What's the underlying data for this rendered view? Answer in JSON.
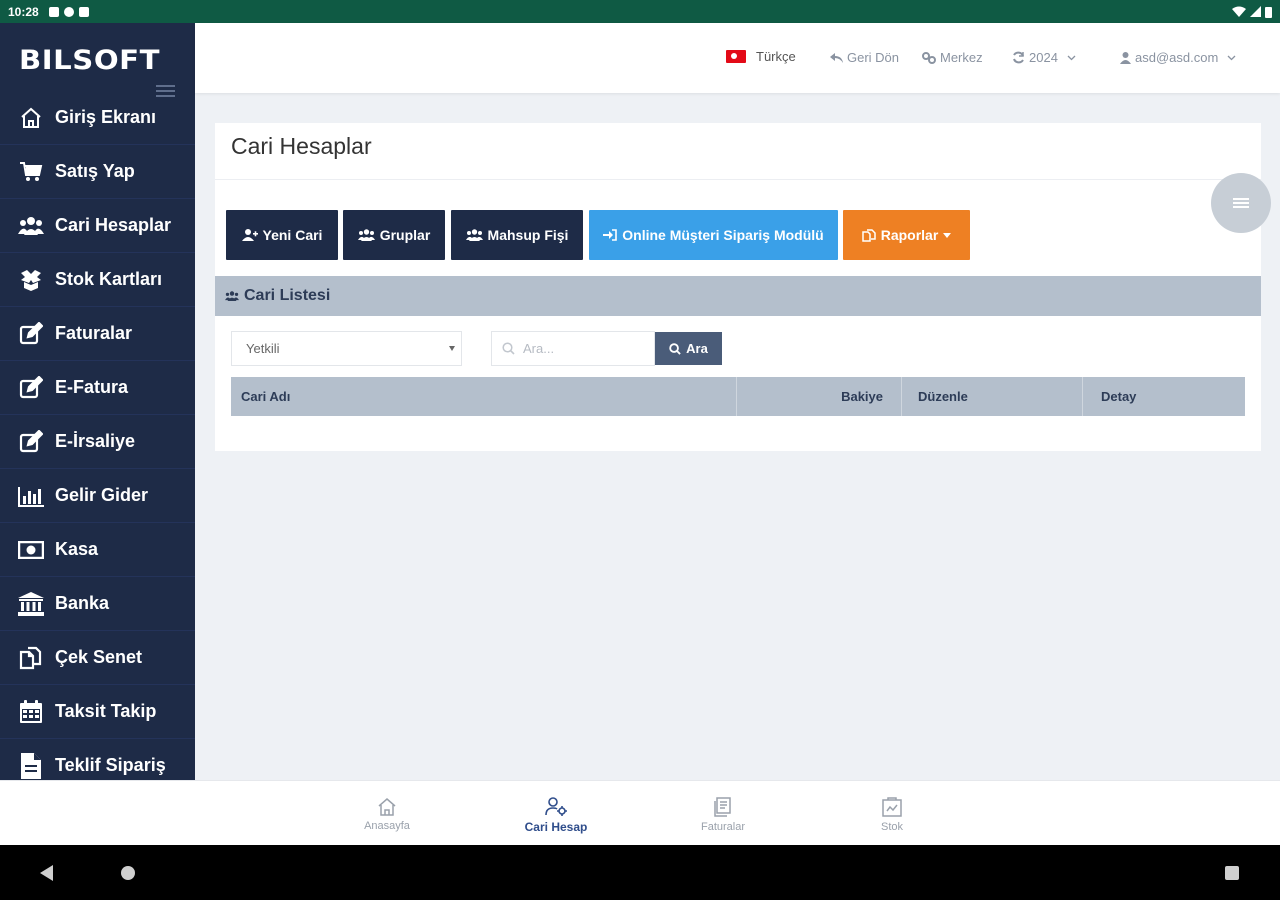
{
  "status_bar": {
    "time": "10:28"
  },
  "app": {
    "logo": "BILSOFT"
  },
  "sidebar": {
    "items": [
      {
        "label": "Giriş Ekranı",
        "icon": "home-icon"
      },
      {
        "label": "Satış Yap",
        "icon": "cart-icon"
      },
      {
        "label": "Cari Hesaplar",
        "icon": "users-icon"
      },
      {
        "label": "Stok Kartları",
        "icon": "stock-icon"
      },
      {
        "label": "Faturalar",
        "icon": "edit-icon"
      },
      {
        "label": "E-Fatura",
        "icon": "edit-icon"
      },
      {
        "label": "E-İrsaliye",
        "icon": "edit-icon"
      },
      {
        "label": "Gelir Gider",
        "icon": "bar-chart-icon"
      },
      {
        "label": "Kasa",
        "icon": "money-icon"
      },
      {
        "label": "Banka",
        "icon": "bank-icon"
      },
      {
        "label": "Çek Senet",
        "icon": "documents-icon"
      },
      {
        "label": "Taksit Takip",
        "icon": "calendar-icon"
      },
      {
        "label": "Teklif Sipariş",
        "icon": "file-icon"
      }
    ]
  },
  "topbar": {
    "language": "Türkçe",
    "back": "Geri Dön",
    "branch": "Merkez",
    "year": "2024",
    "user": "asd@asd.com"
  },
  "page": {
    "title": "Cari Hesaplar",
    "buttons": {
      "new": "Yeni Cari",
      "groups": "Gruplar",
      "offset": "Mahsup Fişi",
      "online": "Online Müşteri Sipariş Modülü",
      "reports": "Raporlar"
    },
    "list_title": "Cari Listesi",
    "filter": {
      "selected": "Yetkili"
    },
    "search": {
      "placeholder": "Ara...",
      "button": "Ara"
    },
    "table": {
      "columns": [
        "Cari Adı",
        "Bakiye",
        "Düzenle",
        "Detay"
      ]
    }
  },
  "bottom_nav": {
    "items": [
      {
        "label": "Anasayfa",
        "icon": "home-icon"
      },
      {
        "label": "Cari Hesap",
        "icon": "user-settings-icon",
        "active": true
      },
      {
        "label": "Faturalar",
        "icon": "invoice-icon"
      },
      {
        "label": "Stok",
        "icon": "stock-box-icon"
      }
    ]
  },
  "colors": {
    "sidebar": "#1e2b47",
    "primary_button": "#1e2b47",
    "online_button": "#3aa0e8",
    "reports_button": "#ee8023",
    "status_bar": "#0f5a44"
  }
}
